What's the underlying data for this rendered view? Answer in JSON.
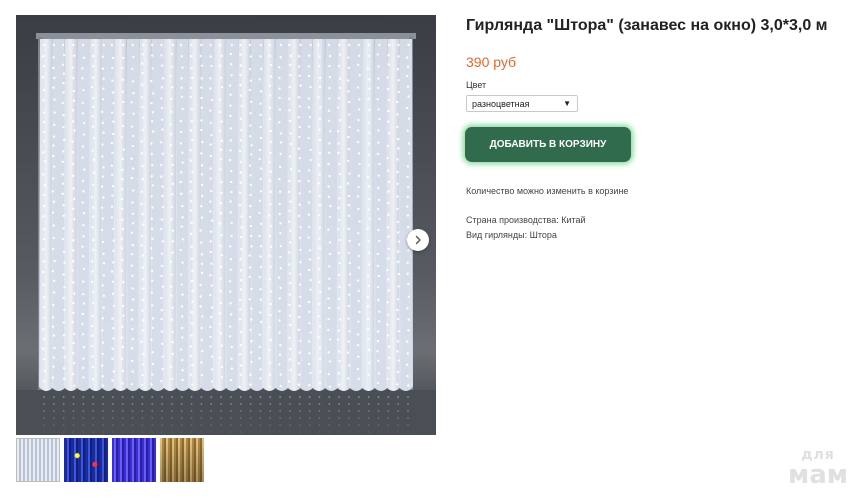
{
  "product": {
    "title": "Гирлянда \"Штора\" (занавес на окно) 3,0*3,0 м",
    "price": "390 руб",
    "color_label": "Цвет",
    "color_selected": "разноцветная",
    "add_to_cart_label": "ДОБАВИТЬ В КОРЗИНУ",
    "quantity_note": "Количество можно изменить в корзине",
    "specs": [
      "Страна производства: Китай",
      "Вид гирлянды: Штора"
    ]
  },
  "gallery": {
    "main_image": "white-led-curtain-garland-photo",
    "thumbnails": [
      {
        "name": "white-curtain-thumbnail",
        "active": true
      },
      {
        "name": "multicolor-curtain-thumbnail",
        "active": false
      },
      {
        "name": "blue-curtain-thumbnail",
        "active": false
      },
      {
        "name": "warm-white-curtain-thumbnail",
        "active": false
      }
    ],
    "next_icon": "chevron-right-icon"
  },
  "watermark": {
    "line1": "для",
    "line2": "мам"
  }
}
